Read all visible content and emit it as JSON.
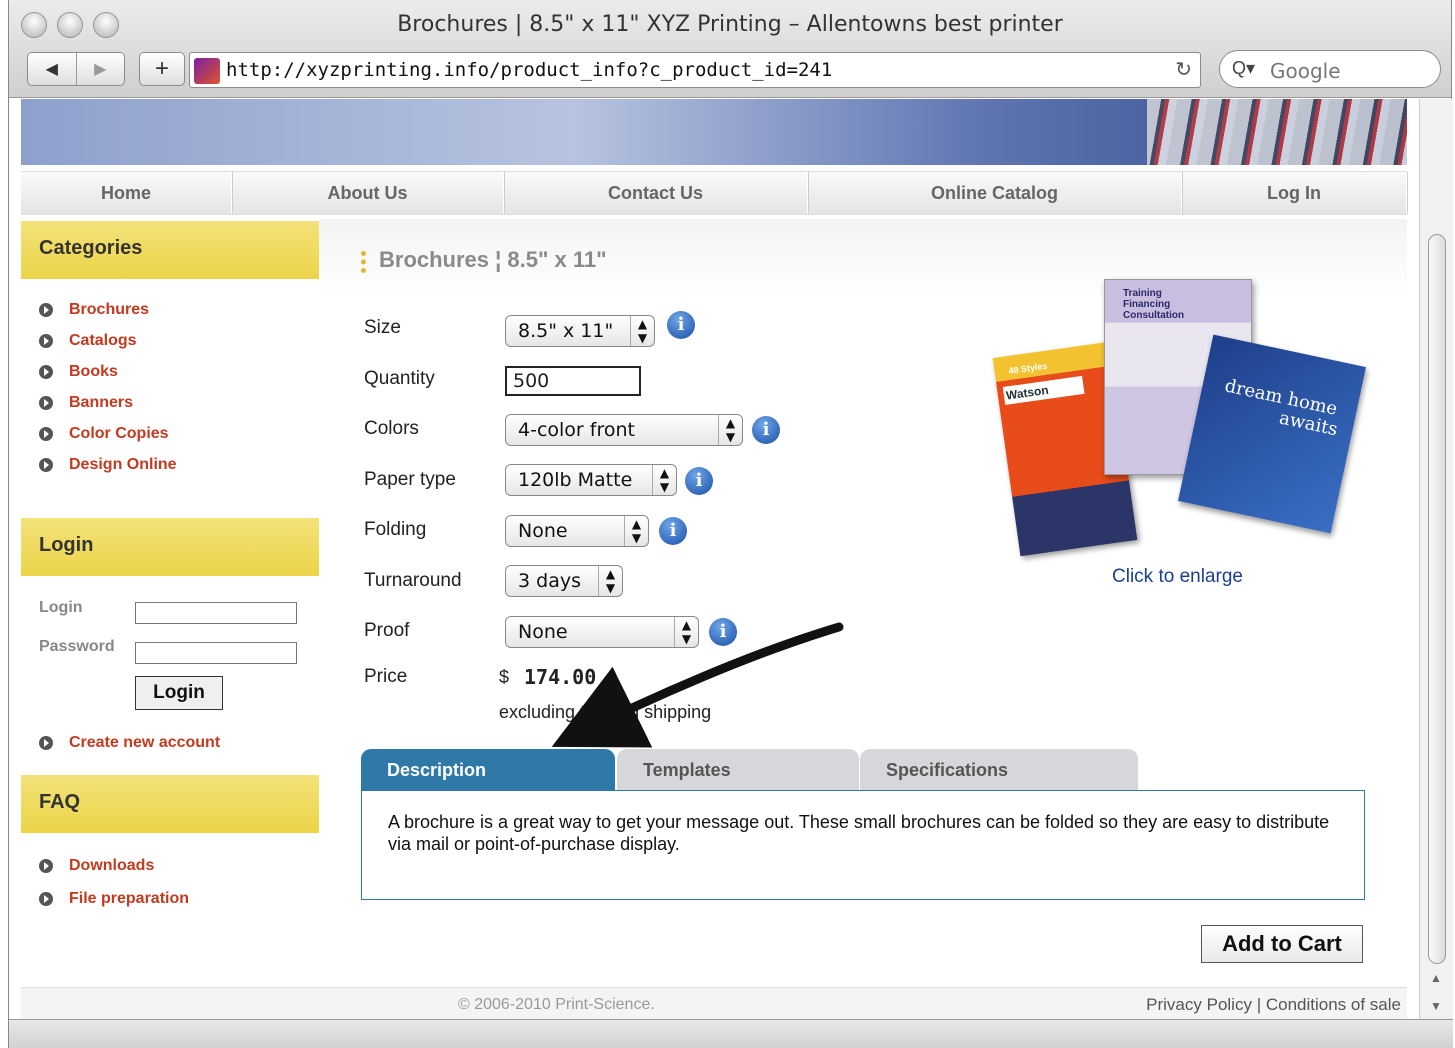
{
  "browser": {
    "window_title": "Brochures | 8.5\" x 11\" XYZ Printing – Allentowns best printer",
    "back": "◀",
    "forward": "▶",
    "new_tab": "+",
    "url": "http://xyzprinting.info/product_info?c_product_id=241",
    "reload": "↻",
    "search_icon": "Q▾",
    "search_placeholder": "Google"
  },
  "nav": {
    "items": [
      "Home",
      "About Us",
      "Contact Us",
      "Online Catalog",
      "Log In"
    ]
  },
  "sidebar": {
    "categories_title": "Categories",
    "categories": [
      "Brochures",
      "Catalogs",
      "Books",
      "Banners",
      "Color Copies",
      "Design Online"
    ],
    "login_title": "Login",
    "login_label": "Login",
    "password_label": "Password",
    "login_button": "Login",
    "create_account": "Create new account",
    "faq_title": "FAQ",
    "faq_items": [
      "Downloads",
      "File preparation"
    ]
  },
  "product": {
    "title": "Brochures ¦ 8.5\" x 11\"",
    "options": {
      "size": {
        "label": "Size",
        "value": "8.5\" x 11\""
      },
      "quantity": {
        "label": "Quantity",
        "value": "500"
      },
      "colors": {
        "label": "Colors",
        "value": "4-color front"
      },
      "paper": {
        "label": "Paper type",
        "value": "120lb Matte"
      },
      "folding": {
        "label": "Folding",
        "value": "None"
      },
      "turnaround": {
        "label": "Turnaround",
        "value": "3 days"
      },
      "proof": {
        "label": "Proof",
        "value": "None"
      }
    },
    "price_label": "Price",
    "currency": "$",
    "price": "174.00",
    "price_note": "excluding tax and shipping",
    "click_to_enlarge": "Click to enlarge",
    "image_text": {
      "training": "Training",
      "financing": "Financing",
      "consultation": "Consultation",
      "watson": "Watson",
      "styles": "48 Styles",
      "dream1": "dream home",
      "dream2": "awaits"
    }
  },
  "tabs": {
    "description": "Description",
    "templates": "Templates",
    "specifications": "Specifications",
    "panel_text": "A brochure is a great way to get your message out. These small brochures can be folded so they are easy to distribute via mail or point-of-purchase display."
  },
  "cart": {
    "add_label": "Add to Cart"
  },
  "footer": {
    "copyright": "© 2006-2010 Print-Science.",
    "privacy": "Privacy Policy",
    "separator": "|",
    "conditions": "Conditions of sale"
  },
  "colors": {
    "accent_tab": "#2f79a8",
    "sidebar_header": "#ecd448",
    "link_red": "#c33a1f"
  }
}
